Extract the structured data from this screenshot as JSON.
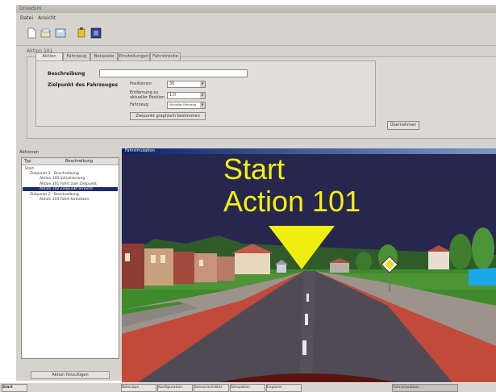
{
  "app": {
    "title": "DriveSim",
    "menu": [
      "Datei",
      "Ansicht"
    ],
    "window_label": "Aktion 101"
  },
  "tabs": [
    "Aktion",
    "Fahrzeug",
    "Beispiele",
    "Einstellungen",
    "Fahrstrecke"
  ],
  "form": {
    "beschreibung_label": "Beschreibung",
    "beschreibung_value": "",
    "zielpunkt_label": "Zielpunkt des Fahrzeuges",
    "position_label": "Positionsnr.",
    "position_value": "30",
    "entfernung_label": "Entfernung zu aktueller Position",
    "entfernung_value": "1.0",
    "fahrzeug_label": "Fahrzeug",
    "fahrzeug_value": "Aktuelles Fahrzeug",
    "zielpunkt_button": "Zielpunkt graphisch bestimmen",
    "apply_button": "Übernehmen"
  },
  "left_panel": {
    "title": "Aktionen",
    "col_typ": "Typ",
    "col_beschreibung": "Beschreibung",
    "items": [
      "Start",
      "Zielpunkt 1 - Beschreibung",
      "Aktion 100 Initialisierung",
      "Aktion 101 Fahrt zum Zielpunkt",
      "Aktion 102 Zielpunkt erreicht",
      "Zielpunkt 2 - Beschreibung",
      "Aktion 103 Fahrt fortsetzen"
    ],
    "button": "Aktion hinzufügen"
  },
  "viewer": {
    "title": "Fahrsimulation",
    "line1": "Start",
    "line2": "Action 101"
  },
  "taskbar": {
    "start": "Start",
    "items": [
      "Netscape",
      "Konfiguration",
      "Szenario-Editor",
      "Simulation",
      "Explorer",
      "Fahrsimulation"
    ]
  },
  "colors": {
    "overlay_text": "#f5f10a",
    "arrow": "#f0ee10",
    "sky": "#26264f"
  }
}
